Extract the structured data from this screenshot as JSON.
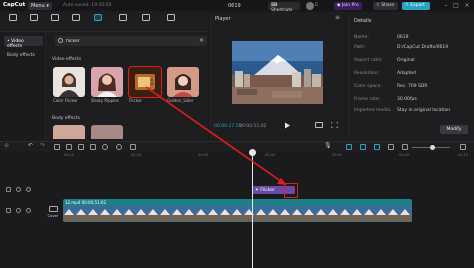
{
  "titlebar": {
    "logo": "CapCut",
    "menu_label": "Menu",
    "autosave": "Auto saved: 19:35:50",
    "project_name": "0619",
    "shortcuts_label": "Shortcuts",
    "user_name": "C",
    "join_pro_label": "Join Pro",
    "share_label": "Share",
    "export_label": "Export"
  },
  "toolbar": {
    "tools": [
      {
        "label": "Import",
        "icon": "import-icon"
      },
      {
        "label": "Audio",
        "icon": "audio-icon"
      },
      {
        "label": "Text",
        "icon": "text-icon"
      },
      {
        "label": "Stickers",
        "icon": "stickers-icon"
      },
      {
        "label": "Effects",
        "icon": "effects-icon",
        "active": true
      },
      {
        "label": "Transitions",
        "icon": "transitions-icon"
      },
      {
        "label": "Filters",
        "icon": "filters-icon"
      },
      {
        "label": "Adjustment",
        "icon": "adjustment-icon"
      }
    ]
  },
  "sidebar": {
    "items": [
      {
        "label": "• Video effects",
        "selected": true
      },
      {
        "label": "Body effects",
        "selected": false
      }
    ]
  },
  "effects": {
    "search_value": "flicker",
    "video_effects_title": "Video effects",
    "body_effects_title": "Body effects",
    "video_cards": [
      {
        "caption": "Color Flicker"
      },
      {
        "caption": "Shaky Ripples"
      },
      {
        "caption": "Flicker"
      },
      {
        "caption": "Golden_Sider"
      }
    ]
  },
  "player": {
    "title": "Player",
    "timecode": "00:00:27:21",
    "duration": "00:00:51:02"
  },
  "details": {
    "title": "Details",
    "rows": [
      {
        "key": "Name:",
        "value": "0619"
      },
      {
        "key": "Path:",
        "value": "D:/CapCut Drafts/0619"
      },
      {
        "key": "Aspect ratio:",
        "value": "Original"
      },
      {
        "key": "Resolution:",
        "value": "Adapted"
      },
      {
        "key": "Color space:",
        "value": "Rec. 709 SDR"
      },
      {
        "key": "Frame rate:",
        "value": "30.00fps"
      },
      {
        "key": "Imported media:",
        "value": "Stay in original location"
      }
    ],
    "modify_label": "Modify"
  },
  "timeline": {
    "ticks": [
      "00:10",
      "00:20",
      "00:30",
      "00:40",
      "00:50",
      "01:00",
      "01:10"
    ],
    "effect_clip_label": "Flicker",
    "video_clip_label": "12.mp4  00:00:51:02",
    "cover_label": "Cover"
  },
  "colors": {
    "accent": "#2aa3c3",
    "effect_clip": "#6a4aa6",
    "video_clip": "#1e7f88",
    "annotation": "#e21c1c"
  }
}
